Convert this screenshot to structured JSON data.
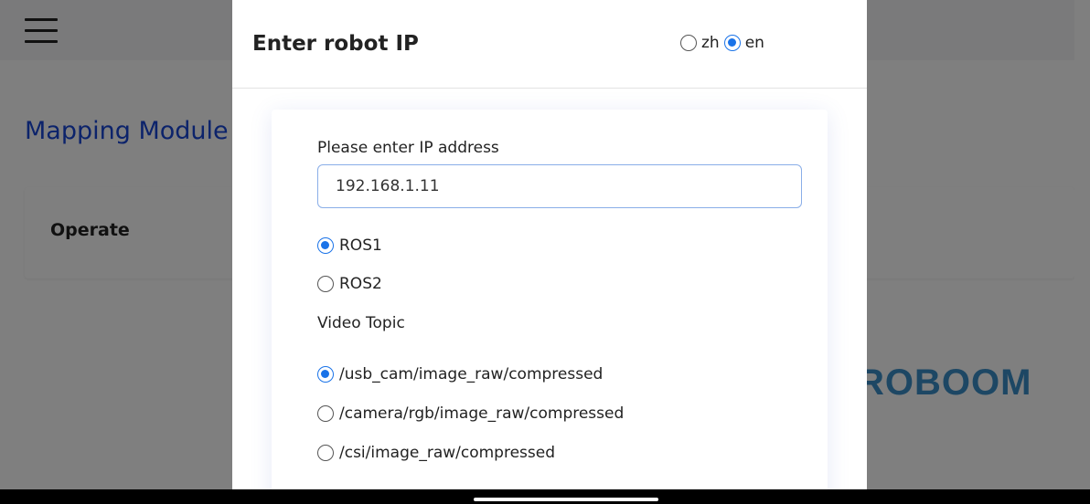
{
  "background": {
    "page_title": "Mapping Module",
    "card_title": "Operate",
    "logo_text": "ROBOOM"
  },
  "modal": {
    "title": "Enter robot IP",
    "lang_options": [
      {
        "label": "zh",
        "selected": false
      },
      {
        "label": "en",
        "selected": true
      }
    ],
    "ip_label": "Please enter IP address",
    "ip_value": "192.168.1.11",
    "ros_options": [
      {
        "label": "ROS1",
        "selected": true
      },
      {
        "label": "ROS2",
        "selected": false
      }
    ],
    "video_topic_label": "Video Topic",
    "video_topics": [
      {
        "label": "/usb_cam/image_raw/compressed",
        "selected": true
      },
      {
        "label": "/camera/rgb/image_raw/compressed",
        "selected": false
      },
      {
        "label": "/csi/image_raw/compressed",
        "selected": false
      }
    ]
  },
  "colors": {
    "accent": "#1a73e8",
    "title_blue": "#1847d6",
    "logo": "#3b8fc9"
  }
}
